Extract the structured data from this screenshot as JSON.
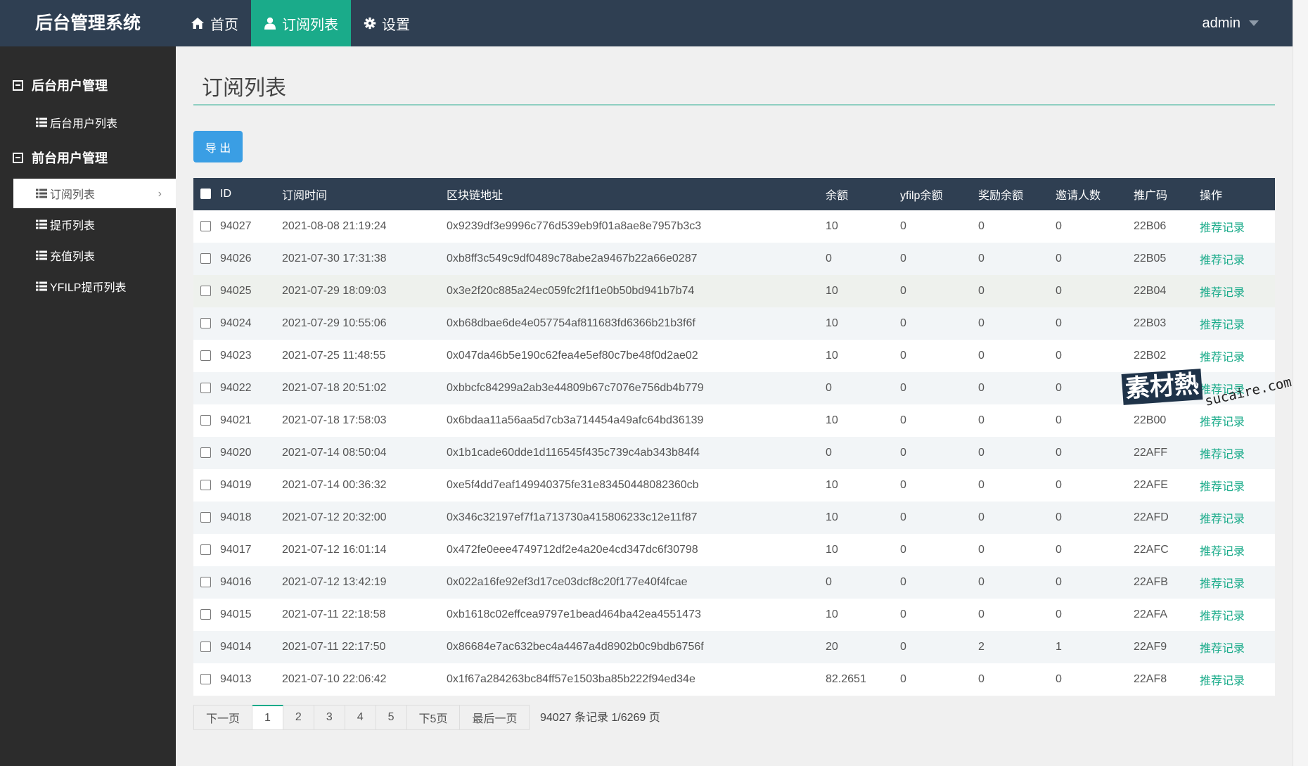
{
  "app": {
    "title": "后台管理系统",
    "user": "admin"
  },
  "nav": [
    {
      "label": "首页",
      "icon": "home-icon"
    },
    {
      "label": "订阅列表",
      "icon": "user-icon",
      "active": true
    },
    {
      "label": "设置",
      "icon": "gear-icon"
    }
  ],
  "sidebar": {
    "groups": [
      {
        "label": "后台用户管理",
        "items": [
          {
            "label": "后台用户列表"
          }
        ]
      },
      {
        "label": "前台用户管理",
        "items": [
          {
            "label": "订阅列表",
            "active": true
          },
          {
            "label": "提币列表"
          },
          {
            "label": "充值列表"
          },
          {
            "label": "YFILP提币列表"
          }
        ]
      }
    ]
  },
  "main": {
    "title": "订阅列表",
    "export_label": "导 出",
    "columns": [
      "ID",
      "订阅时间",
      "区块链地址",
      "余额",
      "yfilp余额",
      "奖励余额",
      "邀请人数",
      "推广码",
      "操作"
    ],
    "action_label": "推荐记录",
    "rows": [
      [
        "94027",
        "2021-08-08 21:19:24",
        "0x9239df3e9996c776d539eb9f01a8ae8e7957b3c3",
        "10",
        "0",
        "0",
        "0",
        "22B06"
      ],
      [
        "94026",
        "2021-07-30 17:31:38",
        "0xb8ff3c549c9df0489c78abe2a9467b22a66e0287",
        "0",
        "0",
        "0",
        "0",
        "22B05"
      ],
      [
        "94025",
        "2021-07-29 18:09:03",
        "0x3e2f20c885a24ec059fc2f1f1e0b50bd941b7b74",
        "10",
        "0",
        "0",
        "0",
        "22B04"
      ],
      [
        "94024",
        "2021-07-29 10:55:06",
        "0xb68dbae6de4e057754af811683fd6366b21b3f6f",
        "10",
        "0",
        "0",
        "0",
        "22B03"
      ],
      [
        "94023",
        "2021-07-25 11:48:55",
        "0x047da46b5e190c62fea4e5ef80c7be48f0d2ae02",
        "10",
        "0",
        "0",
        "0",
        "22B02"
      ],
      [
        "94022",
        "2021-07-18 20:51:02",
        "0xbbcfc84299a2ab3e44809b67c7076e756db4b779",
        "0",
        "0",
        "0",
        "0",
        ""
      ],
      [
        "94021",
        "2021-07-18 17:58:03",
        "0x6bdaa11a56aa5d7cb3a714454a49afc64bd36139",
        "10",
        "0",
        "0",
        "0",
        "22B00"
      ],
      [
        "94020",
        "2021-07-14 08:50:04",
        "0x1b1cade60dde1d116545f435c739c4ab343b84f4",
        "0",
        "0",
        "0",
        "0",
        "22AFF"
      ],
      [
        "94019",
        "2021-07-14 00:36:32",
        "0xe5f4dd7eaf149940375fe31e83450448082360cb",
        "10",
        "0",
        "0",
        "0",
        "22AFE"
      ],
      [
        "94018",
        "2021-07-12 20:32:00",
        "0x346c32197ef7f1a713730a415806233c12e11f87",
        "10",
        "0",
        "0",
        "0",
        "22AFD"
      ],
      [
        "94017",
        "2021-07-12 16:01:14",
        "0x472fe0eee4749712df2e4a20e4cd347dc6f30798",
        "10",
        "0",
        "0",
        "0",
        "22AFC"
      ],
      [
        "94016",
        "2021-07-12 13:42:19",
        "0x022a16fe92ef3d17ce03dcf8c20f177e40f4fcae",
        "0",
        "0",
        "0",
        "0",
        "22AFB"
      ],
      [
        "94015",
        "2021-07-11 22:18:58",
        "0xb1618c02effcea9797e1bead464ba42ea4551473",
        "10",
        "0",
        "0",
        "0",
        "22AFA"
      ],
      [
        "94014",
        "2021-07-11 22:17:50",
        "0x86684e7ac632bec4a4467a4d8902b0c9bdb6756f",
        "20",
        "0",
        "2",
        "1",
        "22AF9"
      ],
      [
        "94013",
        "2021-07-10 22:06:42",
        "0x1f67a284263bc84ff57e1503ba85b222f94ed34e",
        "82.2651",
        "0",
        "0",
        "0",
        "22AF8"
      ]
    ]
  },
  "pagination": {
    "prev_label": "下一页",
    "pages": [
      "1",
      "2",
      "3",
      "4",
      "5"
    ],
    "current": "1",
    "next5_label": "下5页",
    "last_label": "最后一页",
    "info": "94027 条记录 1/6269 页"
  },
  "watermark": {
    "cn": "素材熱",
    "en": "sucaire.com"
  },
  "colors": {
    "topbar": "#2f3f52",
    "accent": "#1aab8a",
    "sidebar": "#2c2c2c",
    "button": "#3a9ee4"
  }
}
